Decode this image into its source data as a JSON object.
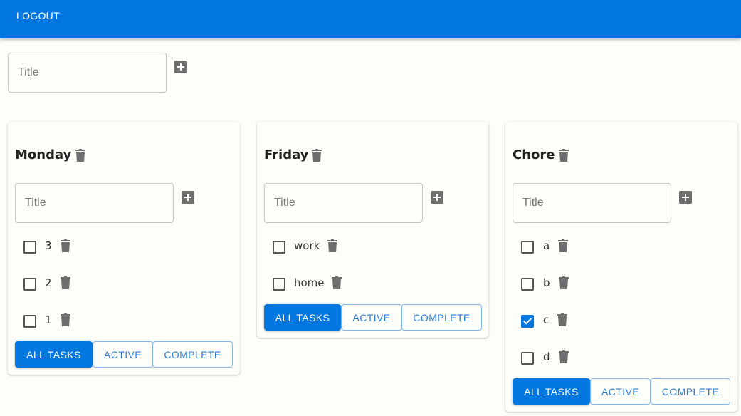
{
  "appbar": {
    "logout_label": "LOGOUT"
  },
  "new_list": {
    "placeholder": "Title",
    "add_icon": "plus-square-icon"
  },
  "filters": {
    "all": "ALL TASKS",
    "active": "ACTIVE",
    "complete": "COMPLETE"
  },
  "colors": {
    "primary": "#0277df",
    "icon_gray": "#6e6e6e"
  },
  "lists": [
    {
      "title": "Monday",
      "placeholder": "Title",
      "active_filter": "all",
      "tasks": [
        {
          "label": "3",
          "done": false
        },
        {
          "label": "2",
          "done": false
        },
        {
          "label": "1",
          "done": false
        }
      ]
    },
    {
      "title": "Friday",
      "placeholder": "Title",
      "active_filter": "all",
      "tasks": [
        {
          "label": "work",
          "done": false
        },
        {
          "label": "home",
          "done": false
        }
      ]
    },
    {
      "title": "Chore",
      "placeholder": "Title",
      "active_filter": "all",
      "tasks": [
        {
          "label": "a",
          "done": false
        },
        {
          "label": "b",
          "done": false
        },
        {
          "label": "c",
          "done": true
        },
        {
          "label": "d",
          "done": false
        }
      ]
    }
  ]
}
